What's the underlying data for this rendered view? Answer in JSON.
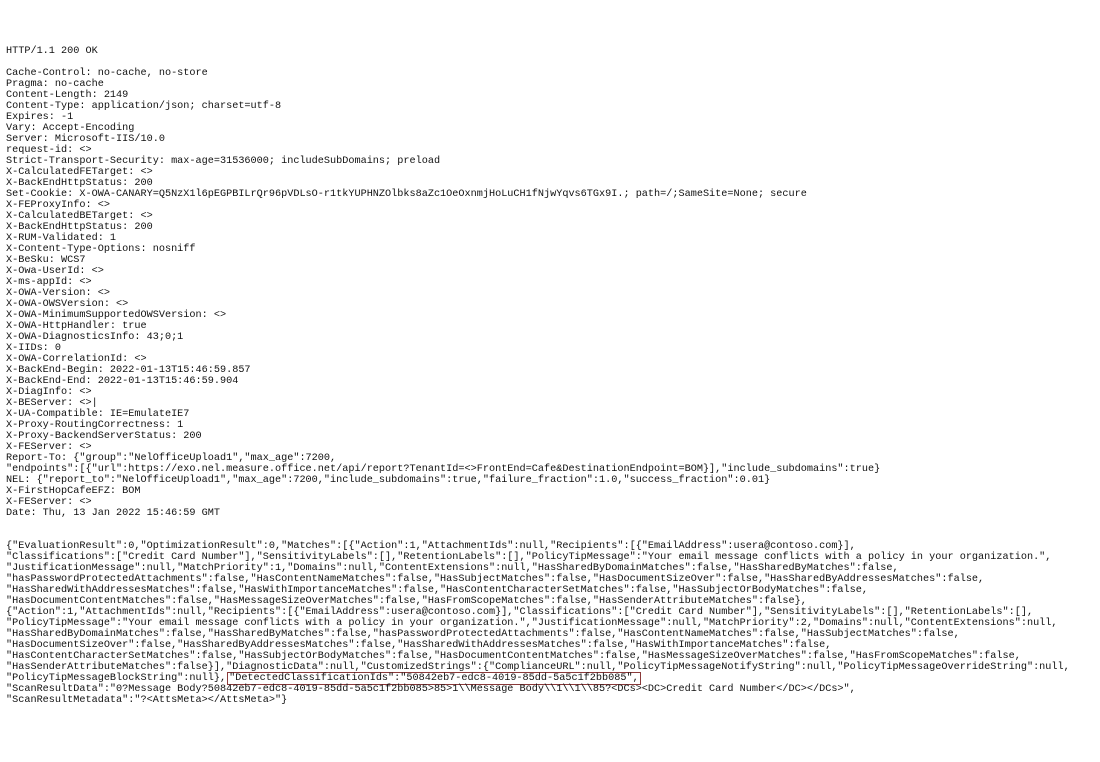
{
  "http": {
    "status_line": "HTTP/1.1 200 OK",
    "headers": [
      "Cache-Control: no-cache, no-store",
      "Pragma: no-cache",
      "Content-Length: 2149",
      "Content-Type: application/json; charset=utf-8",
      "Expires: -1",
      "Vary: Accept-Encoding",
      "Server: Microsoft-IIS/10.0",
      "request-id: <>",
      "Strict-Transport-Security: max-age=31536000; includeSubDomains; preload",
      "X-CalculatedFETarget: <>",
      "X-BackEndHttpStatus: 200",
      "Set-Cookie: X-OWA-CANARY=Q5NzX1l6pEGPBILrQr96pVDLsO-r1tkYUPHNZOlbks8aZc1OeOxnmjHoLuCH1fNjwYqvs6TGx9I.; path=/;SameSite=None; secure",
      "X-FEProxyInfo: <>",
      "X-CalculatedBETarget: <>",
      "X-BackEndHttpStatus: 200",
      "X-RUM-Validated: 1",
      "X-Content-Type-Options: nosniff",
      "X-BeSku: WCS7",
      "X-Owa-UserId: <>",
      "X-ms-appId: <>",
      "X-OWA-Version: <>",
      "X-OWA-OWSVersion: <>",
      "X-OWA-MinimumSupportedOWSVersion: <>",
      "X-OWA-HttpHandler: true",
      "X-OWA-DiagnosticsInfo: 43;0;1",
      "X-IIDs: 0",
      "X-OWA-CorrelationId: <>",
      "X-BackEnd-Begin: 2022-01-13T15:46:59.857",
      "X-BackEnd-End: 2022-01-13T15:46:59.904",
      "X-DiagInfo: <>",
      "X-BEServer: <>|",
      "X-UA-Compatible: IE=EmulateIE7",
      "X-Proxy-RoutingCorrectness: 1",
      "X-Proxy-BackendServerStatus: 200",
      "X-FEServer: <>",
      "Report-To: {\"group\":\"NelOfficeUpload1\",\"max_age\":7200,",
      "\"endpoints\":[{\"url\":https://exo.nel.measure.office.net/api/report?TenantId=<>FrontEnd=Cafe&DestinationEndpoint=BOM}],\"include_subdomains\":true}",
      "NEL: {\"report_to\":\"NelOfficeUpload1\",\"max_age\":7200,\"include_subdomains\":true,\"failure_fraction\":1.0,\"success_fraction\":0.01}",
      "X-FirstHopCafeEFZ: BOM",
      "X-FEServer: <>",
      "Date: Thu, 13 Jan 2022 15:46:59 GMT"
    ]
  },
  "body": {
    "pre": "{\"EvaluationResult\":0,\"OptimizationResult\":0,\"Matches\":[{\"Action\":1,\"AttachmentIds\":null,\"Recipients\":[{\"EmailAddress\":usera@contoso.com}],\n\"Classifications\":[\"Credit Card Number\"],\"SensitivityLabels\":[],\"RetentionLabels\":[],\"PolicyTipMessage\":\"Your email message conflicts with a policy in your organization.\",\n\"JustificationMessage\":null,\"MatchPriority\":1,\"Domains\":null,\"ContentExtensions\":null,\"HasSharedByDomainMatches\":false,\"HasSharedByMatches\":false,\n\"hasPasswordProtectedAttachments\":false,\"HasContentNameMatches\":false,\"HasSubjectMatches\":false,\"HasDocumentSizeOver\":false,\"HasSharedByAddressesMatches\":false,\n\"HasSharedWithAddressesMatches\":false,\"HasWithImportanceMatches\":false,\"HasContentCharacterSetMatches\":false,\"HasSubjectOrBodyMatches\":false,\n\"HasDocumentContentMatches\":false,\"HasMessageSizeOverMatches\":false,\"HasFromScopeMatches\":false,\"HasSenderAttributeMatches\":false},\n{\"Action\":1,\"AttachmentIds\":null,\"Recipients\":[{\"EmailAddress\":usera@contoso.com}],\"Classifications\":[\"Credit Card Number\"],\"SensitivityLabels\":[],\"RetentionLabels\":[],\n\"PolicyTipMessage\":\"Your email message conflicts with a policy in your organization.\",\"JustificationMessage\":null,\"MatchPriority\":2,\"Domains\":null,\"ContentExtensions\":null,\n\"HasSharedByDomainMatches\":false,\"HasSharedByMatches\":false,\"hasPasswordProtectedAttachments\":false,\"HasContentNameMatches\":false,\"HasSubjectMatches\":false,\n\"HasDocumentSizeOver\":false,\"HasSharedByAddressesMatches\":false,\"HasSharedWithAddressesMatches\":false,\"HasWithImportanceMatches\":false,\n\"HasContentCharacterSetMatches\":false,\"HasSubjectOrBodyMatches\":false,\"HasDocumentContentMatches\":false,\"HasMessageSizeOverMatches\":false,\"HasFromScopeMatches\":false,\n\"HasSenderAttributeMatches\":false}],\"DiagnosticData\":null,\"CustomizedStrings\":{\"ComplianceURL\":null,\"PolicyTipMessageNotifyString\":null,\"PolicyTipMessageOverrideString\":null,\n\"PolicyTipMessageBlockString\":null},",
    "highlight_text": "\"DetectedClassificationIds\":\"50842eb7-edc8-4019-85dd-5a5c1f2bb085\",",
    "post": "\n\"ScanResultData\":\"0?Message Body?50842eb7-edc8-4019-85dd-5a5c1f2bb085>85>1\\\\Message Body\\\\1\\\\1\\\\85?<DCs><DC>Credit Card Number</DC></DCs>\",\n\"ScanResultMetadata\":\"?<AttsMeta></AttsMeta>\"}"
  },
  "highlight": {
    "key": "DetectedClassificationIds",
    "value": "50842eb7-edc8-4019-85dd-5a5c1f2bb085"
  }
}
